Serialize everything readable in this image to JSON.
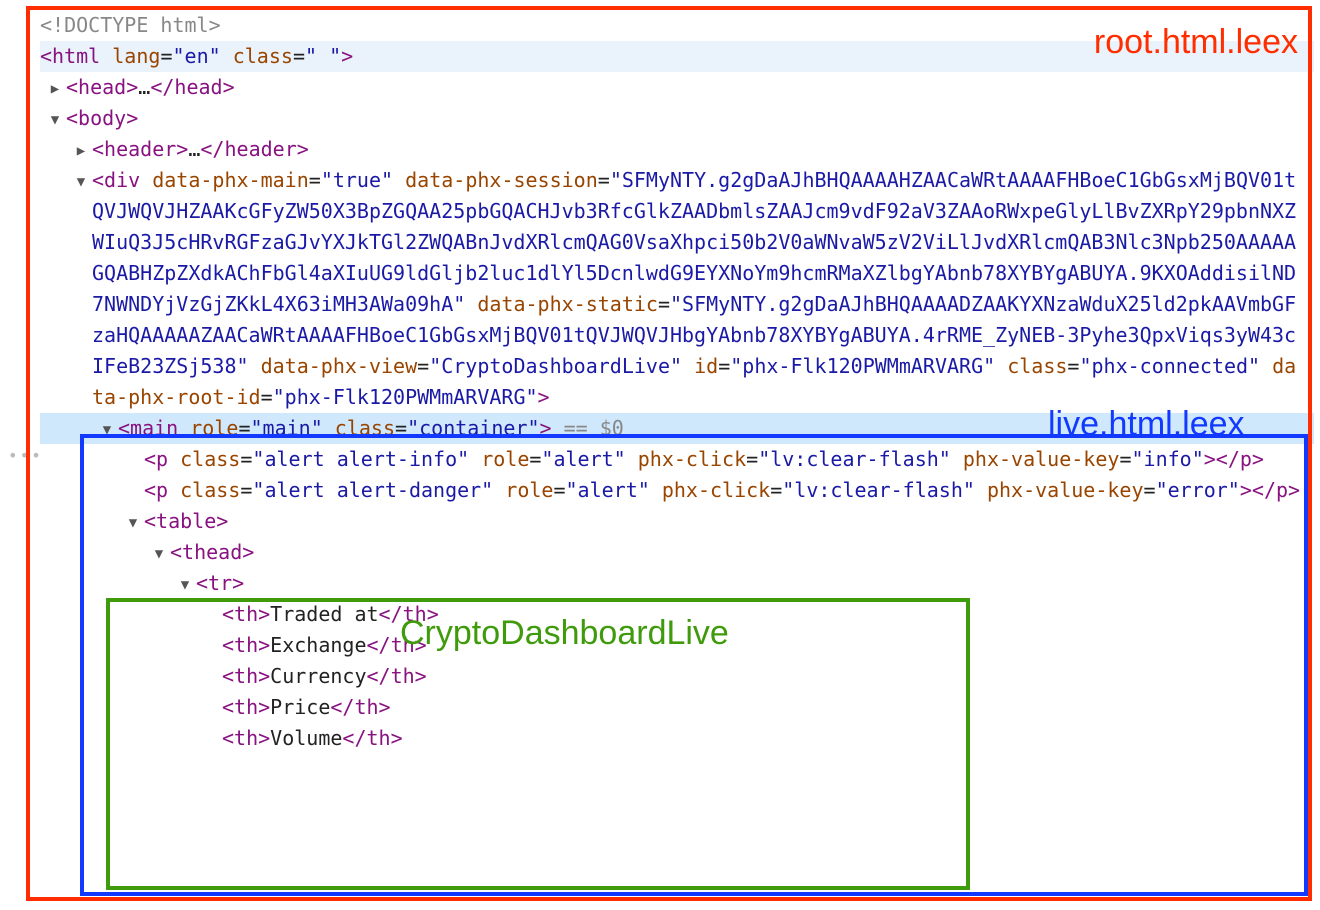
{
  "doctype": "<!DOCTYPE html>",
  "html_open": {
    "tag": "html",
    "attrs": [
      {
        "n": "lang",
        "v": "en"
      },
      {
        "n": "class",
        "v": " "
      }
    ]
  },
  "head": {
    "tag": "head",
    "ellipsis": "…"
  },
  "body_open": {
    "tag": "body"
  },
  "header": {
    "tag": "header",
    "ellipsis": "…"
  },
  "phx_div": {
    "tag": "div",
    "attrs": [
      {
        "n": "data-phx-main",
        "v": "true"
      },
      {
        "n": "data-phx-session",
        "v": "SFMyNTY.g2gDaAJhBHQAAAAHZAACaWRtAAAAFHBoeC1GbGsxMjBQV01tQVJWQVJHZAAKcGFyZW50X3BpZGQAA25pbGQACHJvb3RfcGlkZAADbmlsZAAJcm9vdF92aV3ZAAoRWxpeGlyLlBvZXRpY29pbnNXZWIuQ3J5cHRvRGFzaGJvYXJkTGl2ZWQABnJvdXRlcmQAG0VsaXhpci50b2V0aWNvaW5zV2ViLlJvdXRlcmQAB3Nlc3Npb250AAAAAGQABHZpZXdkAChFbGl4aXIuUG9ldGljb2luc1dlYl5DcnlwdG9EYXNoYm9hcmRMaXZlbgYAbnb78XYBYgABUYA.9KXOAddisilND7NWNDYjVzGjZKkL4X63iMH3AWa09hA"
      },
      {
        "n": "data-phx-static",
        "v": "SFMyNTY.g2gDaAJhBHQAAAADZAAKYXNzaWduX25ld2pkAAVmbGFzaHQAAAAAZAACaWRtAAAAFHBoeC1GbGsxMjBQV01tQVJWQVJHbgYAbnb78XYBYgABUYA.4rRME_ZyNEB-3Pyhe3QpxViqs3yW43cIFeB23ZSj538"
      },
      {
        "n": "data-phx-view",
        "v": "CryptoDashboardLive"
      },
      {
        "n": "id",
        "v": "phx-Flk120PWMmARVARG"
      },
      {
        "n": "class",
        "v": "phx-connected"
      },
      {
        "n": "data-phx-root-id",
        "v": "phx-Flk120PWMmARVARG"
      }
    ]
  },
  "main": {
    "tag": "main",
    "attrs": [
      {
        "n": "role",
        "v": "main"
      },
      {
        "n": "class",
        "v": "container"
      }
    ],
    "trail": " == $0"
  },
  "alert_info": {
    "tag": "p",
    "attrs": [
      {
        "n": "class",
        "v": "alert alert-info"
      },
      {
        "n": "role",
        "v": "alert"
      },
      {
        "n": "phx-click",
        "v": "lv:clear-flash"
      },
      {
        "n": "phx-value-key",
        "v": "info"
      }
    ]
  },
  "alert_error": {
    "tag": "p",
    "attrs": [
      {
        "n": "class",
        "v": "alert alert-danger"
      },
      {
        "n": "role",
        "v": "alert"
      },
      {
        "n": "phx-click",
        "v": "lv:clear-flash"
      },
      {
        "n": "phx-value-key",
        "v": "error"
      }
    ]
  },
  "table_open": "table",
  "thead_open": "thead",
  "tr_open": "tr",
  "ths": [
    "Traded at",
    "Exchange",
    "Currency",
    "Price",
    "Volume"
  ],
  "overlays": {
    "red": "root.html.leex",
    "blue": "live.html.leex",
    "green": "CryptoDashboardLive"
  }
}
